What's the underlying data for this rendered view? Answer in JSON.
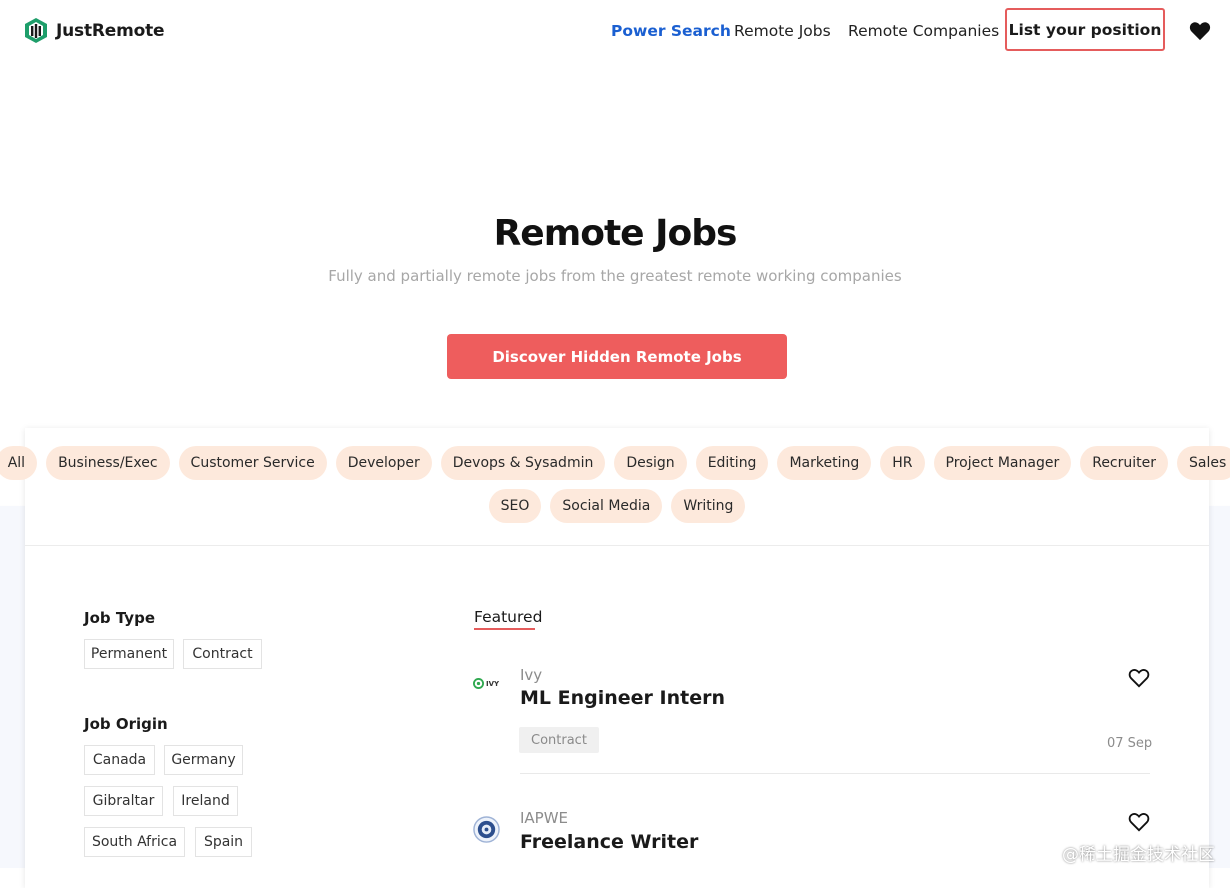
{
  "header": {
    "brand": "JustRemote",
    "nav": [
      "Power Search",
      "Remote Jobs",
      "Remote Companies"
    ],
    "list_button": "List your position",
    "colors": {
      "accent": "#1a5fd1",
      "brand_red": "#ee5d5d"
    }
  },
  "hero": {
    "title": "Remote Jobs",
    "subtitle": "Fully and partially remote jobs from the greatest remote working companies",
    "cta": "Discover Hidden Remote Jobs"
  },
  "categories": {
    "row1": [
      "All",
      "Business/Exec",
      "Customer Service",
      "Developer",
      "Devops & Sysadmin",
      "Design",
      "Editing",
      "Marketing",
      "HR",
      "Project Manager",
      "Recruiter",
      "Sales"
    ],
    "row2": [
      "SEO",
      "Social Media",
      "Writing"
    ]
  },
  "filters": {
    "job_type": {
      "heading": "Job Type",
      "options": [
        "Permanent",
        "Contract"
      ]
    },
    "job_origin": {
      "heading": "Job Origin",
      "options": [
        "Canada",
        "Germany",
        "Gibraltar",
        "Ireland",
        "South Africa",
        "Spain"
      ]
    }
  },
  "featured": {
    "tab_label": "Featured",
    "jobs": [
      {
        "company": "Ivy",
        "logo_text": "IVY",
        "title": "ML Engineer Intern",
        "tag": "Contract",
        "date": "07 Sep"
      },
      {
        "company": "IAPWE",
        "title": "Freelance Writer"
      }
    ]
  },
  "watermark": "@稀土掘金技术社区"
}
